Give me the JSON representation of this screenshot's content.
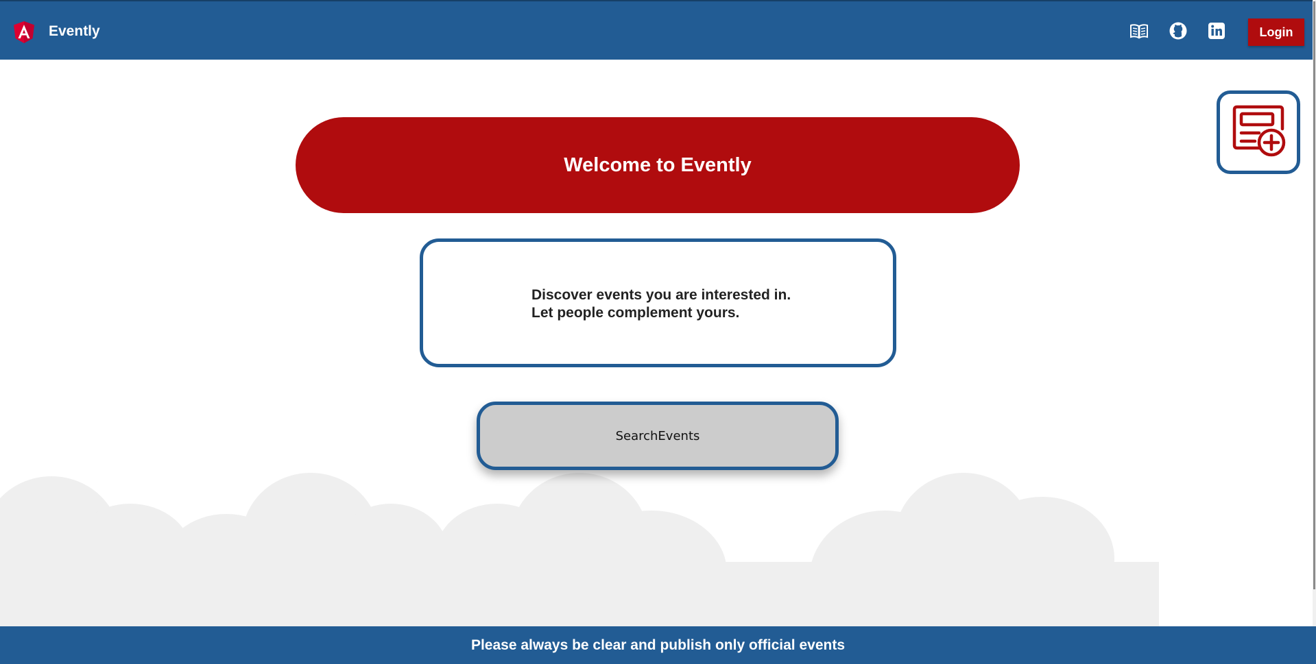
{
  "header": {
    "app_title": "Evently",
    "logo_icon": "angular-logo-icon",
    "icons": [
      "book-icon",
      "github-icon",
      "linkedin-icon"
    ],
    "login_label": "Login"
  },
  "main": {
    "welcome_text": "Welcome to Evently",
    "info_line_1": "Discover events you are interested in.",
    "info_line_2": "Let people complement yours.",
    "search_label": "SearchEvents",
    "add_event_icon": "add-event-icon"
  },
  "footer": {
    "text": "Please always be clear and publish only official events"
  },
  "colors": {
    "primary_blue": "#225c94",
    "accent_red": "#b00c0e",
    "cloud_gray": "#efefef",
    "button_gray": "#cccccc"
  }
}
